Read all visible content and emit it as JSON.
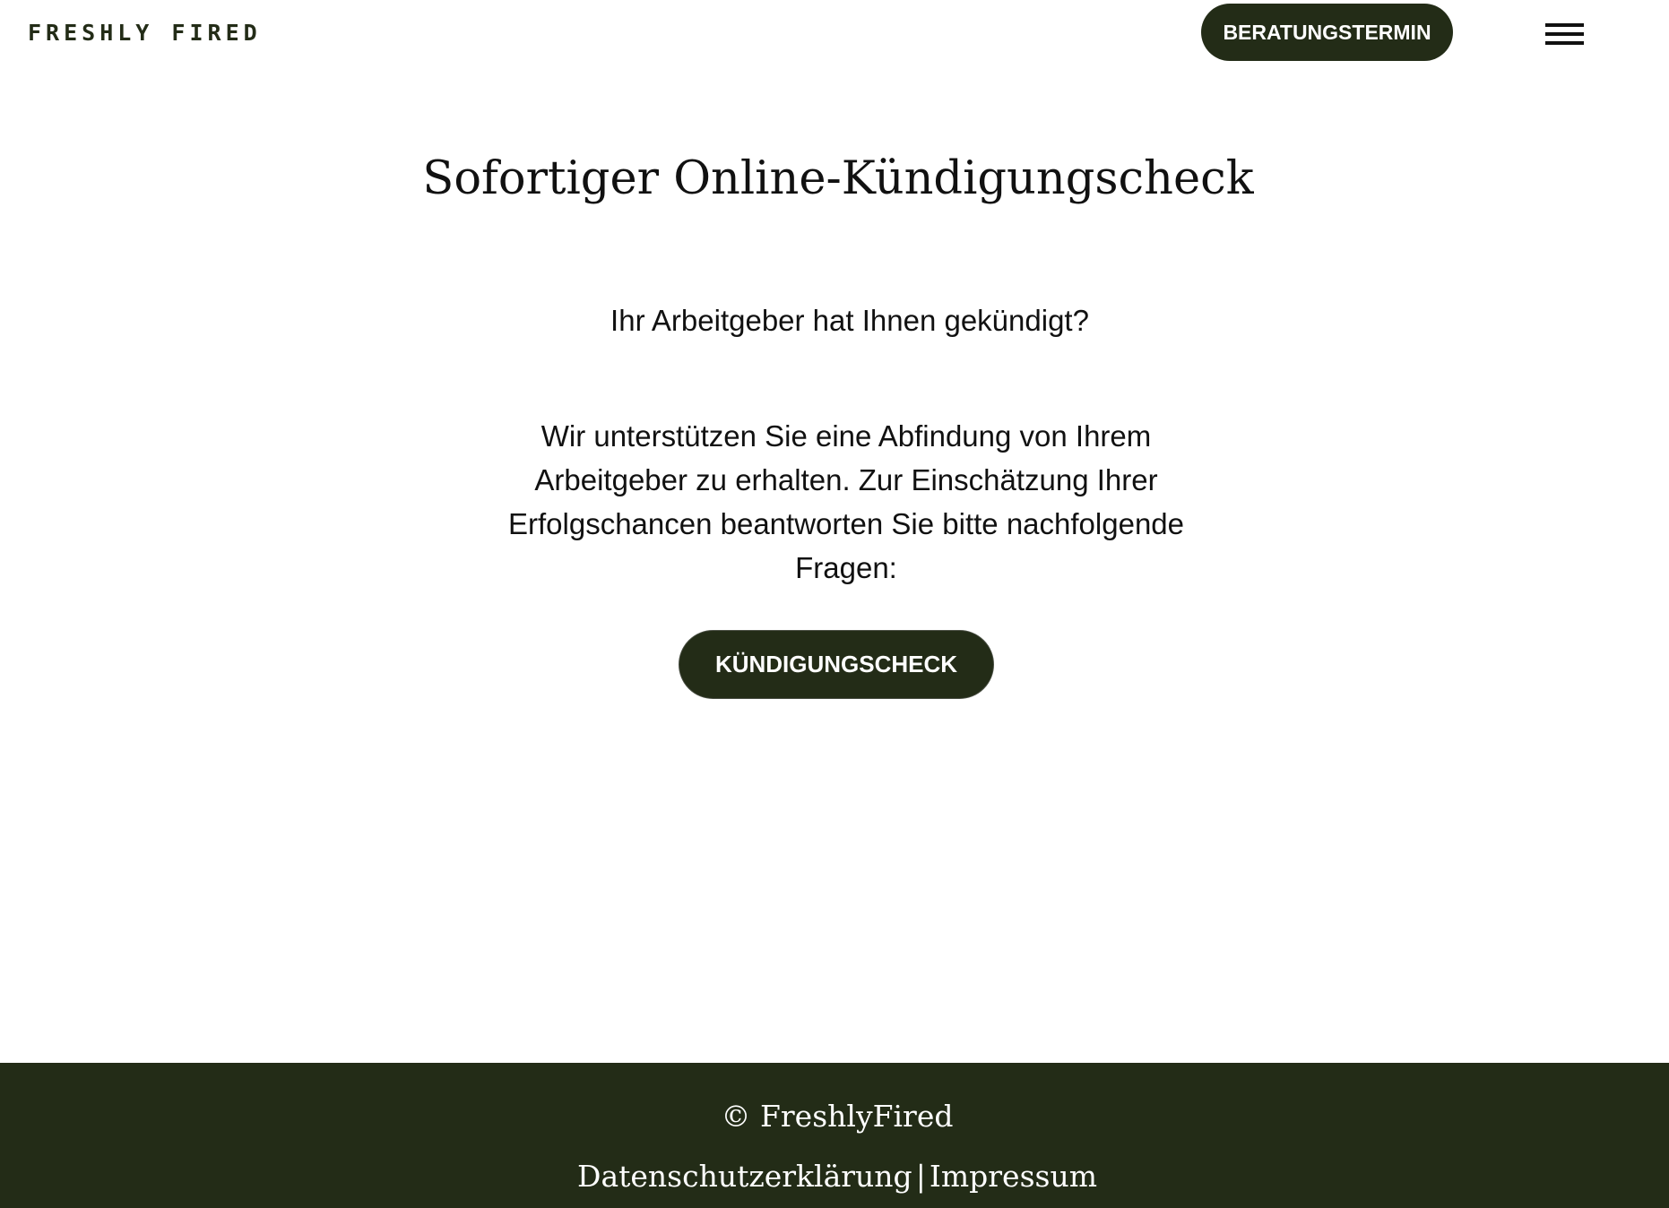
{
  "header": {
    "logo_text": "FRESHLY FIRED",
    "cta_label": "BERATUNGSTERMIN",
    "menu_icon": "hamburger-menu-icon"
  },
  "main": {
    "title": "Sofortiger Online-Kündigungscheck",
    "question": "Ihr Arbeitgeber hat Ihnen gekündigt?",
    "intro": "Wir unterstützen Sie eine Abfindung von Ihrem Arbeitgeber zu erhalten. Zur Einschätzung Ihrer Erfolgschancen beantworten Sie bitte nachfolgende Fragen:",
    "cta_label": "KÜNDIGUNGSCHECK"
  },
  "footer": {
    "copyright": "© FreshlyFired",
    "links": {
      "privacy": "Datenschutzerklärung",
      "separator": "|",
      "imprint": "Impressum"
    }
  },
  "colors": {
    "brand_dark": "#232c17",
    "text": "#111111",
    "background": "#ffffff"
  }
}
